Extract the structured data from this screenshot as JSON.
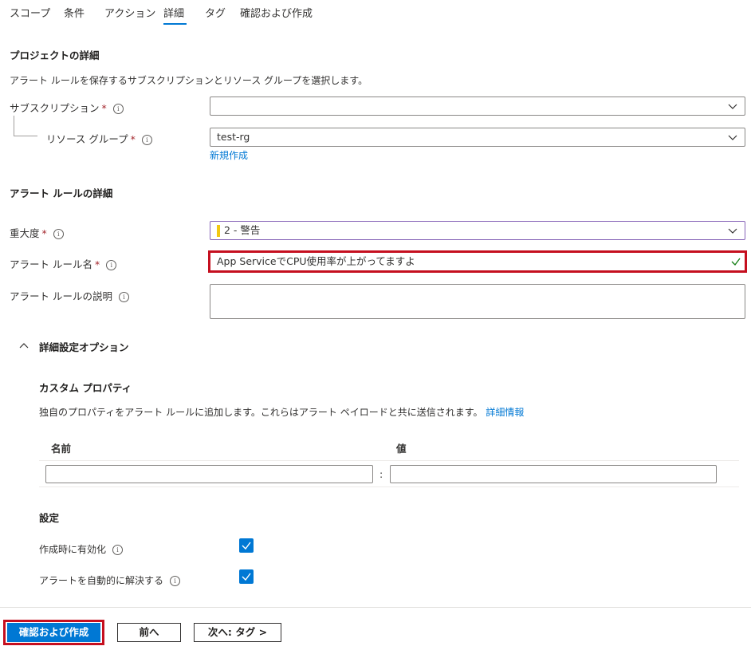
{
  "tabs": [
    {
      "label": "スコープ"
    },
    {
      "label": "条件"
    },
    {
      "label": "アクション"
    },
    {
      "label": "詳細"
    },
    {
      "label": "タグ"
    },
    {
      "label": "確認および作成"
    }
  ],
  "active_tab": "詳細",
  "project": {
    "title": "プロジェクトの詳細",
    "description": "アラート ルールを保存するサブスクリプションとリソース グループを選択します。",
    "subscription_label": "サブスクリプション",
    "subscription_value": "",
    "resource_group_label": "リソース グループ",
    "resource_group_value": "test-rg",
    "create_new_link": "新規作成"
  },
  "rule": {
    "title": "アラート ルールの詳細",
    "severity_label": "重大度",
    "severity_value": "2 - 警告",
    "severity_color": "#f2c811",
    "name_label": "アラート ルール名",
    "name_value": "App ServiceでCPU使用率が上がってますよ",
    "description_label": "アラート ルールの説明",
    "description_value": ""
  },
  "advanced": {
    "title": "詳細設定オプション",
    "custom_props_title": "カスタム プロパティ",
    "custom_props_description": "独自のプロパティをアラート ルールに追加します。これらはアラート ペイロードと共に送信されます。",
    "learn_more_link": "詳細情報",
    "col_name": "名前",
    "col_value": "値",
    "separator": ":",
    "settings_title": "設定",
    "enable_on_create_label": "作成時に有効化",
    "enable_on_create_checked": true,
    "auto_resolve_label": "アラートを自動的に解決する",
    "auto_resolve_checked": true
  },
  "footer": {
    "review_create": "確認および作成",
    "previous": "前へ",
    "next": "次へ: タグ >"
  },
  "colors": {
    "accent": "#0078d4",
    "highlight_border": "#c50f1f",
    "required": "#a4262c",
    "valid_check": "#107c10"
  },
  "icons": [
    "info-icon",
    "chevron-down-icon",
    "checkmark-icon",
    "chevron-up-icon"
  ]
}
